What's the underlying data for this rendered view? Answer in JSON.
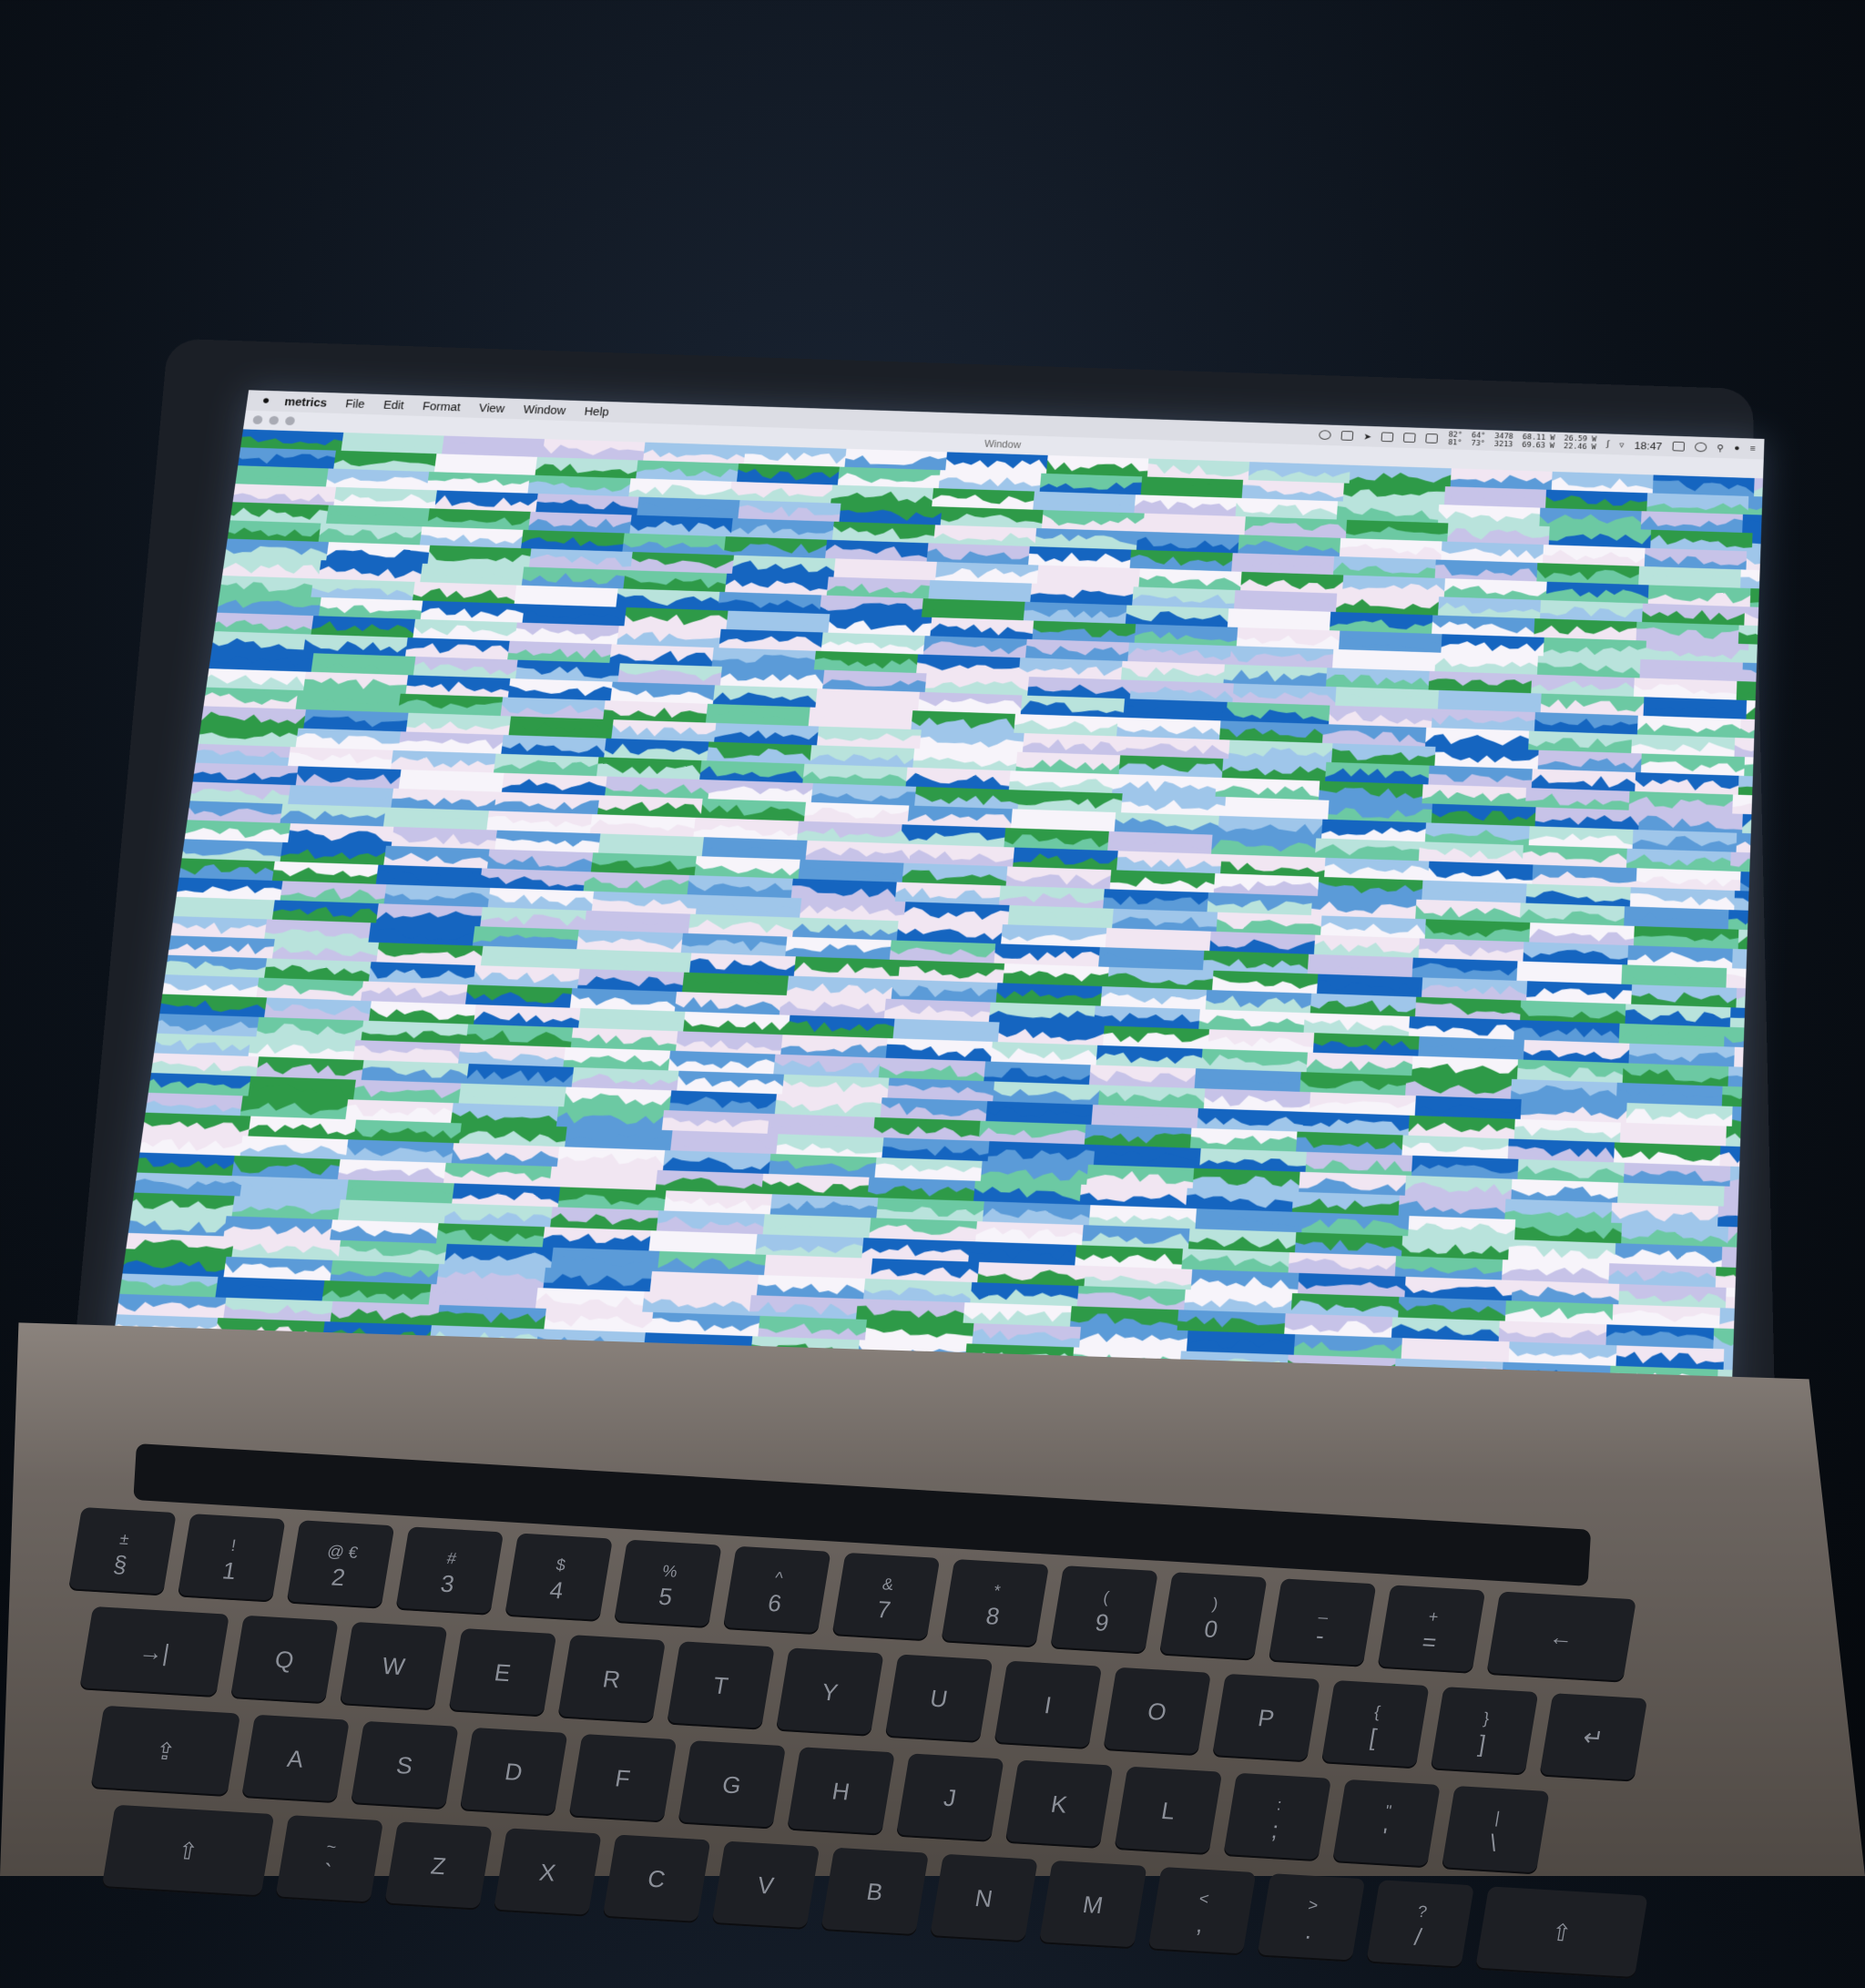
{
  "menubar": {
    "apple_icon": "apple-logo-icon",
    "app_name": "metrics",
    "items": [
      "File",
      "Edit",
      "Format",
      "View",
      "Window",
      "Help"
    ],
    "status": {
      "readout_line1": "82°  64°  3478  68.11 W  26.59 W",
      "readout_line2": "81°  73°  3213  69.63 W  22.46 W",
      "clock": "18:47"
    }
  },
  "window": {
    "title": "Window"
  },
  "palette": {
    "dark_blue": "#1565c0",
    "mid_blue": "#5b9bd8",
    "light_blue": "#9fc6ea",
    "lavender": "#c7c3e8",
    "pale_pink": "#f1e6f2",
    "white": "#f7f4fa",
    "pale_teal": "#b9e3dc",
    "teal": "#6cc9a3",
    "green": "#2e9a48"
  },
  "keyboard": {
    "rows": [
      [
        {
          "top": "±",
          "bottom": "§"
        },
        {
          "top": "!",
          "bottom": "1"
        },
        {
          "top": "@ €",
          "bottom": "2"
        },
        {
          "top": "#",
          "bottom": "3"
        },
        {
          "top": "$",
          "bottom": "4"
        },
        {
          "top": "%",
          "bottom": "5"
        },
        {
          "top": "^",
          "bottom": "6"
        },
        {
          "top": "&",
          "bottom": "7"
        },
        {
          "top": "*",
          "bottom": "8"
        },
        {
          "top": "(",
          "bottom": "9"
        },
        {
          "top": ")",
          "bottom": "0"
        },
        {
          "top": "_",
          "bottom": "-"
        },
        {
          "top": "+",
          "bottom": "="
        },
        {
          "top": "",
          "bottom": "←"
        }
      ],
      [
        {
          "top": "",
          "bottom": "→|"
        },
        {
          "top": "",
          "bottom": "Q"
        },
        {
          "top": "",
          "bottom": "W"
        },
        {
          "top": "",
          "bottom": "E"
        },
        {
          "top": "",
          "bottom": "R"
        },
        {
          "top": "",
          "bottom": "T"
        },
        {
          "top": "",
          "bottom": "Y"
        },
        {
          "top": "",
          "bottom": "U"
        },
        {
          "top": "",
          "bottom": "I"
        },
        {
          "top": "",
          "bottom": "O"
        },
        {
          "top": "",
          "bottom": "P"
        },
        {
          "top": "{",
          "bottom": "["
        },
        {
          "top": "}",
          "bottom": "]"
        },
        {
          "top": "",
          "bottom": "↵"
        }
      ],
      [
        {
          "top": "",
          "bottom": "⇪"
        },
        {
          "top": "",
          "bottom": "A"
        },
        {
          "top": "",
          "bottom": "S"
        },
        {
          "top": "",
          "bottom": "D"
        },
        {
          "top": "",
          "bottom": "F"
        },
        {
          "top": "",
          "bottom": "G"
        },
        {
          "top": "",
          "bottom": "H"
        },
        {
          "top": "",
          "bottom": "J"
        },
        {
          "top": "",
          "bottom": "K"
        },
        {
          "top": "",
          "bottom": "L"
        },
        {
          "top": ":",
          "bottom": ";"
        },
        {
          "top": "\"",
          "bottom": "'"
        },
        {
          "top": "|",
          "bottom": "\\"
        }
      ],
      [
        {
          "top": "",
          "bottom": "⇧"
        },
        {
          "top": "~",
          "bottom": "`"
        },
        {
          "top": "",
          "bottom": "Z"
        },
        {
          "top": "",
          "bottom": "X"
        },
        {
          "top": "",
          "bottom": "C"
        },
        {
          "top": "",
          "bottom": "V"
        },
        {
          "top": "",
          "bottom": "B"
        },
        {
          "top": "",
          "bottom": "N"
        },
        {
          "top": "",
          "bottom": "M"
        },
        {
          "top": "<",
          "bottom": ","
        },
        {
          "top": ">",
          "bottom": "."
        },
        {
          "top": "?",
          "bottom": "/"
        },
        {
          "top": "",
          "bottom": "⇧"
        }
      ]
    ]
  }
}
